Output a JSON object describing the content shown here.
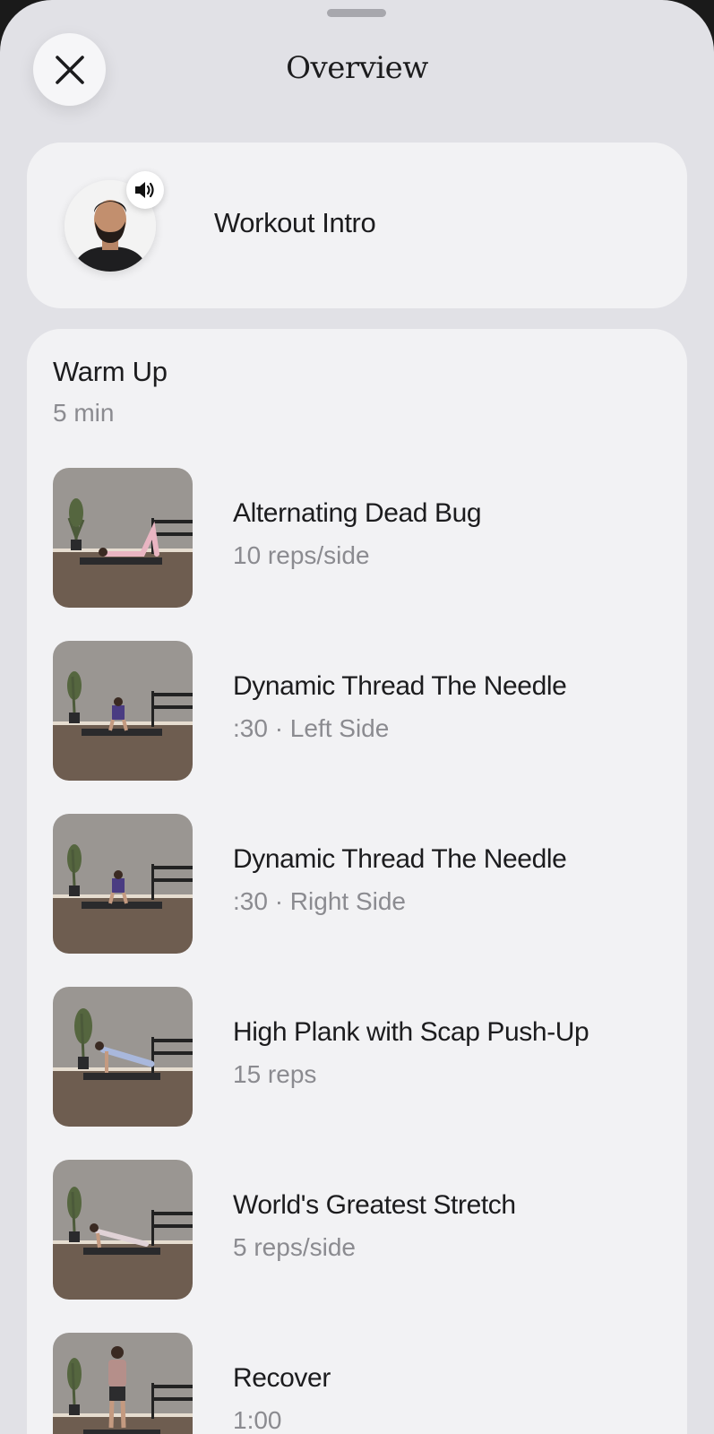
{
  "header": {
    "title": "Overview",
    "close_icon": "close-icon"
  },
  "intro": {
    "label": "Workout Intro",
    "badge_icon": "speaker-icon"
  },
  "section": {
    "title": "Warm Up",
    "duration": "5 min",
    "exercises": [
      {
        "name": "Alternating Dead Bug",
        "detail": "10 reps/side"
      },
      {
        "name": "Dynamic Thread The Needle",
        "detail": ":30 · Left Side"
      },
      {
        "name": "Dynamic Thread The Needle",
        "detail": ":30 · Right Side"
      },
      {
        "name": "High Plank with Scap Push-Up",
        "detail": "15 reps"
      },
      {
        "name": "World's Greatest Stretch",
        "detail": "5 reps/side"
      },
      {
        "name": "Recover",
        "detail": "1:00"
      }
    ]
  },
  "colors": {
    "sheet_background": "#e1e1e6",
    "card_background": "#f2f2f4",
    "primary_text": "#1c1c1e",
    "secondary_text": "#8b8b90"
  }
}
